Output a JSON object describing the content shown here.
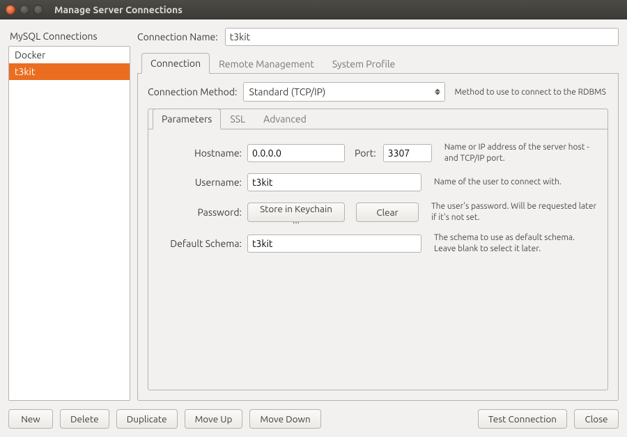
{
  "window": {
    "title": "Manage Server Connections"
  },
  "sidebar": {
    "heading": "MySQL Connections",
    "items": [
      {
        "label": "Docker",
        "selected": false
      },
      {
        "label": "t3kit",
        "selected": true
      }
    ]
  },
  "name_row": {
    "label": "Connection Name:",
    "value": "t3kit"
  },
  "tabs": {
    "items": [
      {
        "label": "Connection",
        "active": true
      },
      {
        "label": "Remote Management",
        "active": false
      },
      {
        "label": "System Profile",
        "active": false
      }
    ]
  },
  "method": {
    "label": "Connection Method:",
    "value": "Standard (TCP/IP)",
    "help": "Method to use to connect to the RDBMS"
  },
  "subtabs": {
    "items": [
      {
        "label": "Parameters",
        "active": true
      },
      {
        "label": "SSL",
        "active": false
      },
      {
        "label": "Advanced",
        "active": false
      }
    ]
  },
  "params": {
    "hostname_label": "Hostname:",
    "hostname": "0.0.0.0",
    "port_label": "Port:",
    "port": "3307",
    "hostname_help": "Name or IP address of the server host - and TCP/IP port.",
    "username_label": "Username:",
    "username": "t3kit",
    "username_help": "Name of the user to connect with.",
    "password_label": "Password:",
    "store_button": "Store in Keychain ...",
    "clear_button": "Clear",
    "password_help": "The user's password. Will be requested later if it's not set.",
    "schema_label": "Default Schema:",
    "schema": "t3kit",
    "schema_help": "The schema to use as default schema. Leave blank to select it later."
  },
  "buttons": {
    "new": "New",
    "delete": "Delete",
    "duplicate": "Duplicate",
    "move_up": "Move Up",
    "move_down": "Move Down",
    "test": "Test Connection",
    "close": "Close"
  }
}
